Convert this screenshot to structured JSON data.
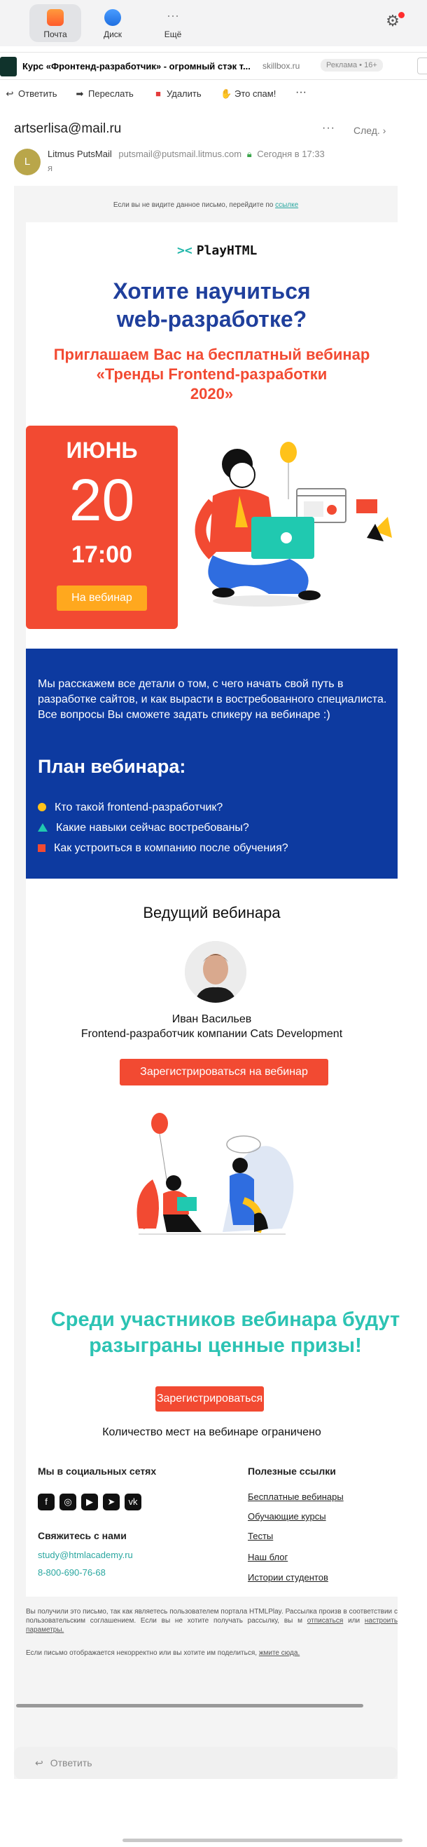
{
  "appbar": {
    "tabs": [
      {
        "label": "Почта",
        "icon": "mail-icon"
      },
      {
        "label": "Диск",
        "icon": "disk-icon"
      },
      {
        "label": "Ещё",
        "icon": "more-icon"
      }
    ]
  },
  "ad": {
    "text": "Курс «Фронтенд-разработчик» - огромный стэк т...",
    "domain": "skillbox.ru",
    "badge": "Реклама • 16+"
  },
  "toolbar": {
    "reply": "Ответить",
    "forward": "Переслать",
    "delete": "Удалить",
    "spam": "Это спам!",
    "more": "···"
  },
  "header": {
    "to": "artserlisa@mail.ru",
    "more": "···",
    "next": "След.",
    "avatar_letter": "L",
    "sender_name": "Litmus PutsMail",
    "sender_addr": "putsmail@putsmail.litmus.com",
    "date": "Сегодня в 17:33",
    "to_me": "я"
  },
  "letter": {
    "preheader_text": "Если вы не видите данное письмо, перейдите по",
    "preheader_link": "ссылке",
    "logo": "PlayHTML",
    "headline_1": "Хотите научиться",
    "headline_2": "web-разработке?",
    "sub_1": "Приглашаем Вас на бесплатный вебинар",
    "sub_2": "«Тренды Frontend-разработки",
    "sub_3": "2020»",
    "month": "ИЮНЬ",
    "day": "20",
    "time": "17:00",
    "webinar_btn": "На вебинар",
    "plan_text": "Мы расскажем все детали о том, с чего начать свой путь в разработке сайтов, и как вырасти в востребованного специалиста. Все вопросы Вы сможете задать спикеру на вебинаре :)",
    "plan_title": "План вебинара:",
    "plan_items": [
      "Кто такой frontend-разработчик?",
      "Какие навыки сейчас востребованы?",
      "Как устроиться в компанию после обучения?"
    ],
    "host_title": "Ведущий вебинара",
    "host_name": "Иван Васильев",
    "host_role": "Frontend-разработчик компании Cats Development",
    "register_btn": "Зарегистрироваться на вебинар",
    "prize_1": "Среди участников вебинара будут",
    "prize_2": "разыграны ценные призы!",
    "register_btn_2": "Зарегистрироваться",
    "limited": "Количество мест на вебинаре ограничено",
    "social_title": "Мы в социальных сетях",
    "contact_title": "Свяжитесь с нами",
    "email": "study@htmlacademy.ru",
    "phone": "8-800-690-76-68",
    "links_title": "Полезные ссылки",
    "links": [
      "Бесплатные вебинары",
      "Обучающие курсы",
      "Тесты",
      "Наш блог",
      "Истории студентов"
    ],
    "legal_1": "Вы получили это письмо, так как являетесь пользователем портала HTMLPlay. Рассылка произв в соответствии с пользовательским соглашением. Если вы не хотите получать рассылку, вы м",
    "legal_unsub": "отписаться",
    "legal_or": "или",
    "legal_settings": "настроить параметры.",
    "legal_2": "Если письмо отображается некорректно или вы хотите им поделиться,",
    "legal_2_link": "жмите сюда."
  },
  "reply_bar": {
    "label": "Ответить"
  },
  "colors": {
    "brand_blue": "#1f3f9c",
    "brand_red": "#f24a32",
    "brand_teal": "#2cc3b3",
    "plan_bg": "#0d3aa0",
    "button_orange": "#ffa81e"
  }
}
